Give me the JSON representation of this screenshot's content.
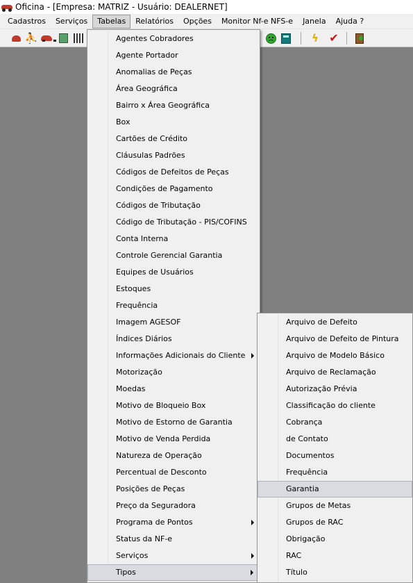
{
  "window": {
    "title": "Oficina - [Empresa: MATRIZ - Usuário: DEALERNET]"
  },
  "menubar": [
    {
      "label": "Cadastros",
      "active": false
    },
    {
      "label": "Serviços",
      "active": false
    },
    {
      "label": "Tabelas",
      "active": true
    },
    {
      "label": "Relatórios",
      "active": false
    },
    {
      "label": "Opções",
      "active": false
    },
    {
      "label": "Monitor Nf-e NFS-e",
      "active": false
    },
    {
      "label": "Janela",
      "active": false
    },
    {
      "label": "Ajuda ?",
      "active": false
    }
  ],
  "toolbar": {
    "icons": [
      "phone-icon",
      "running-man-icon",
      "car-icon",
      "document-icon",
      "barcode-grid-icon",
      "smiley-icon",
      "calculator-icon",
      "lightning-icon",
      "checkmark-icon",
      "exit-door-icon"
    ]
  },
  "tabelas_menu": [
    {
      "label": "Agentes Cobradores",
      "submenu": false
    },
    {
      "label": "Agente Portador",
      "submenu": false
    },
    {
      "label": "Anomalias de Peças",
      "submenu": false
    },
    {
      "label": "Área Geográfica",
      "submenu": false
    },
    {
      "label": "Bairro x Área Geográfica",
      "submenu": false
    },
    {
      "label": "Box",
      "submenu": false
    },
    {
      "label": "Cartões de Crédito",
      "submenu": false
    },
    {
      "label": "Cláusulas Padrões",
      "submenu": false
    },
    {
      "label": "Códigos de Defeitos de Peças",
      "submenu": false
    },
    {
      "label": "Condições de Pagamento",
      "submenu": false
    },
    {
      "label": "Códigos de Tributação",
      "submenu": false
    },
    {
      "label": "Código de Tributação - PIS/COFINS",
      "submenu": false
    },
    {
      "label": "Conta Interna",
      "submenu": false
    },
    {
      "label": "Controle Gerencial Garantia",
      "submenu": false
    },
    {
      "label": "Equipes de Usuários",
      "submenu": false
    },
    {
      "label": "Estoques",
      "submenu": false
    },
    {
      "label": "Frequência",
      "submenu": false
    },
    {
      "label": "Imagem AGESOF",
      "submenu": false
    },
    {
      "label": "Índices Diários",
      "submenu": false
    },
    {
      "label": "Informações Adicionais do Cliente",
      "submenu": true
    },
    {
      "label": "Motorização",
      "submenu": false
    },
    {
      "label": "Moedas",
      "submenu": false
    },
    {
      "label": "Motivo de Bloqueio Box",
      "submenu": false
    },
    {
      "label": "Motivo de Estorno de Garantia",
      "submenu": false
    },
    {
      "label": "Motivo de Venda Perdida",
      "submenu": false
    },
    {
      "label": "Natureza de Operação",
      "submenu": false
    },
    {
      "label": "Percentual de Desconto",
      "submenu": false
    },
    {
      "label": "Posições de Peças",
      "submenu": false
    },
    {
      "label": "Preço da Seguradora",
      "submenu": false
    },
    {
      "label": "Programa de Pontos",
      "submenu": true
    },
    {
      "label": "Status da NF-e",
      "submenu": false
    },
    {
      "label": "Serviços",
      "submenu": true
    },
    {
      "label": "Tipos",
      "submenu": true,
      "active": true
    }
  ],
  "tipos_submenu": [
    {
      "label": "Arquivo de Defeito"
    },
    {
      "label": "Arquivo de Defeito de Pintura"
    },
    {
      "label": "Arquivo de Modelo Básico"
    },
    {
      "label": "Arquivo de Reclamação"
    },
    {
      "label": "Autorização Prévia"
    },
    {
      "label": "Classificação do cliente"
    },
    {
      "label": "Cobrança"
    },
    {
      "label": "de Contato"
    },
    {
      "label": "Documentos"
    },
    {
      "label": "Frequência"
    },
    {
      "label": "Garantia",
      "highlighted": true
    },
    {
      "label": "Grupos de Metas"
    },
    {
      "label": "Grupos de RAC"
    },
    {
      "label": "Obrigação"
    },
    {
      "label": "RAC"
    },
    {
      "label": "Título"
    }
  ]
}
